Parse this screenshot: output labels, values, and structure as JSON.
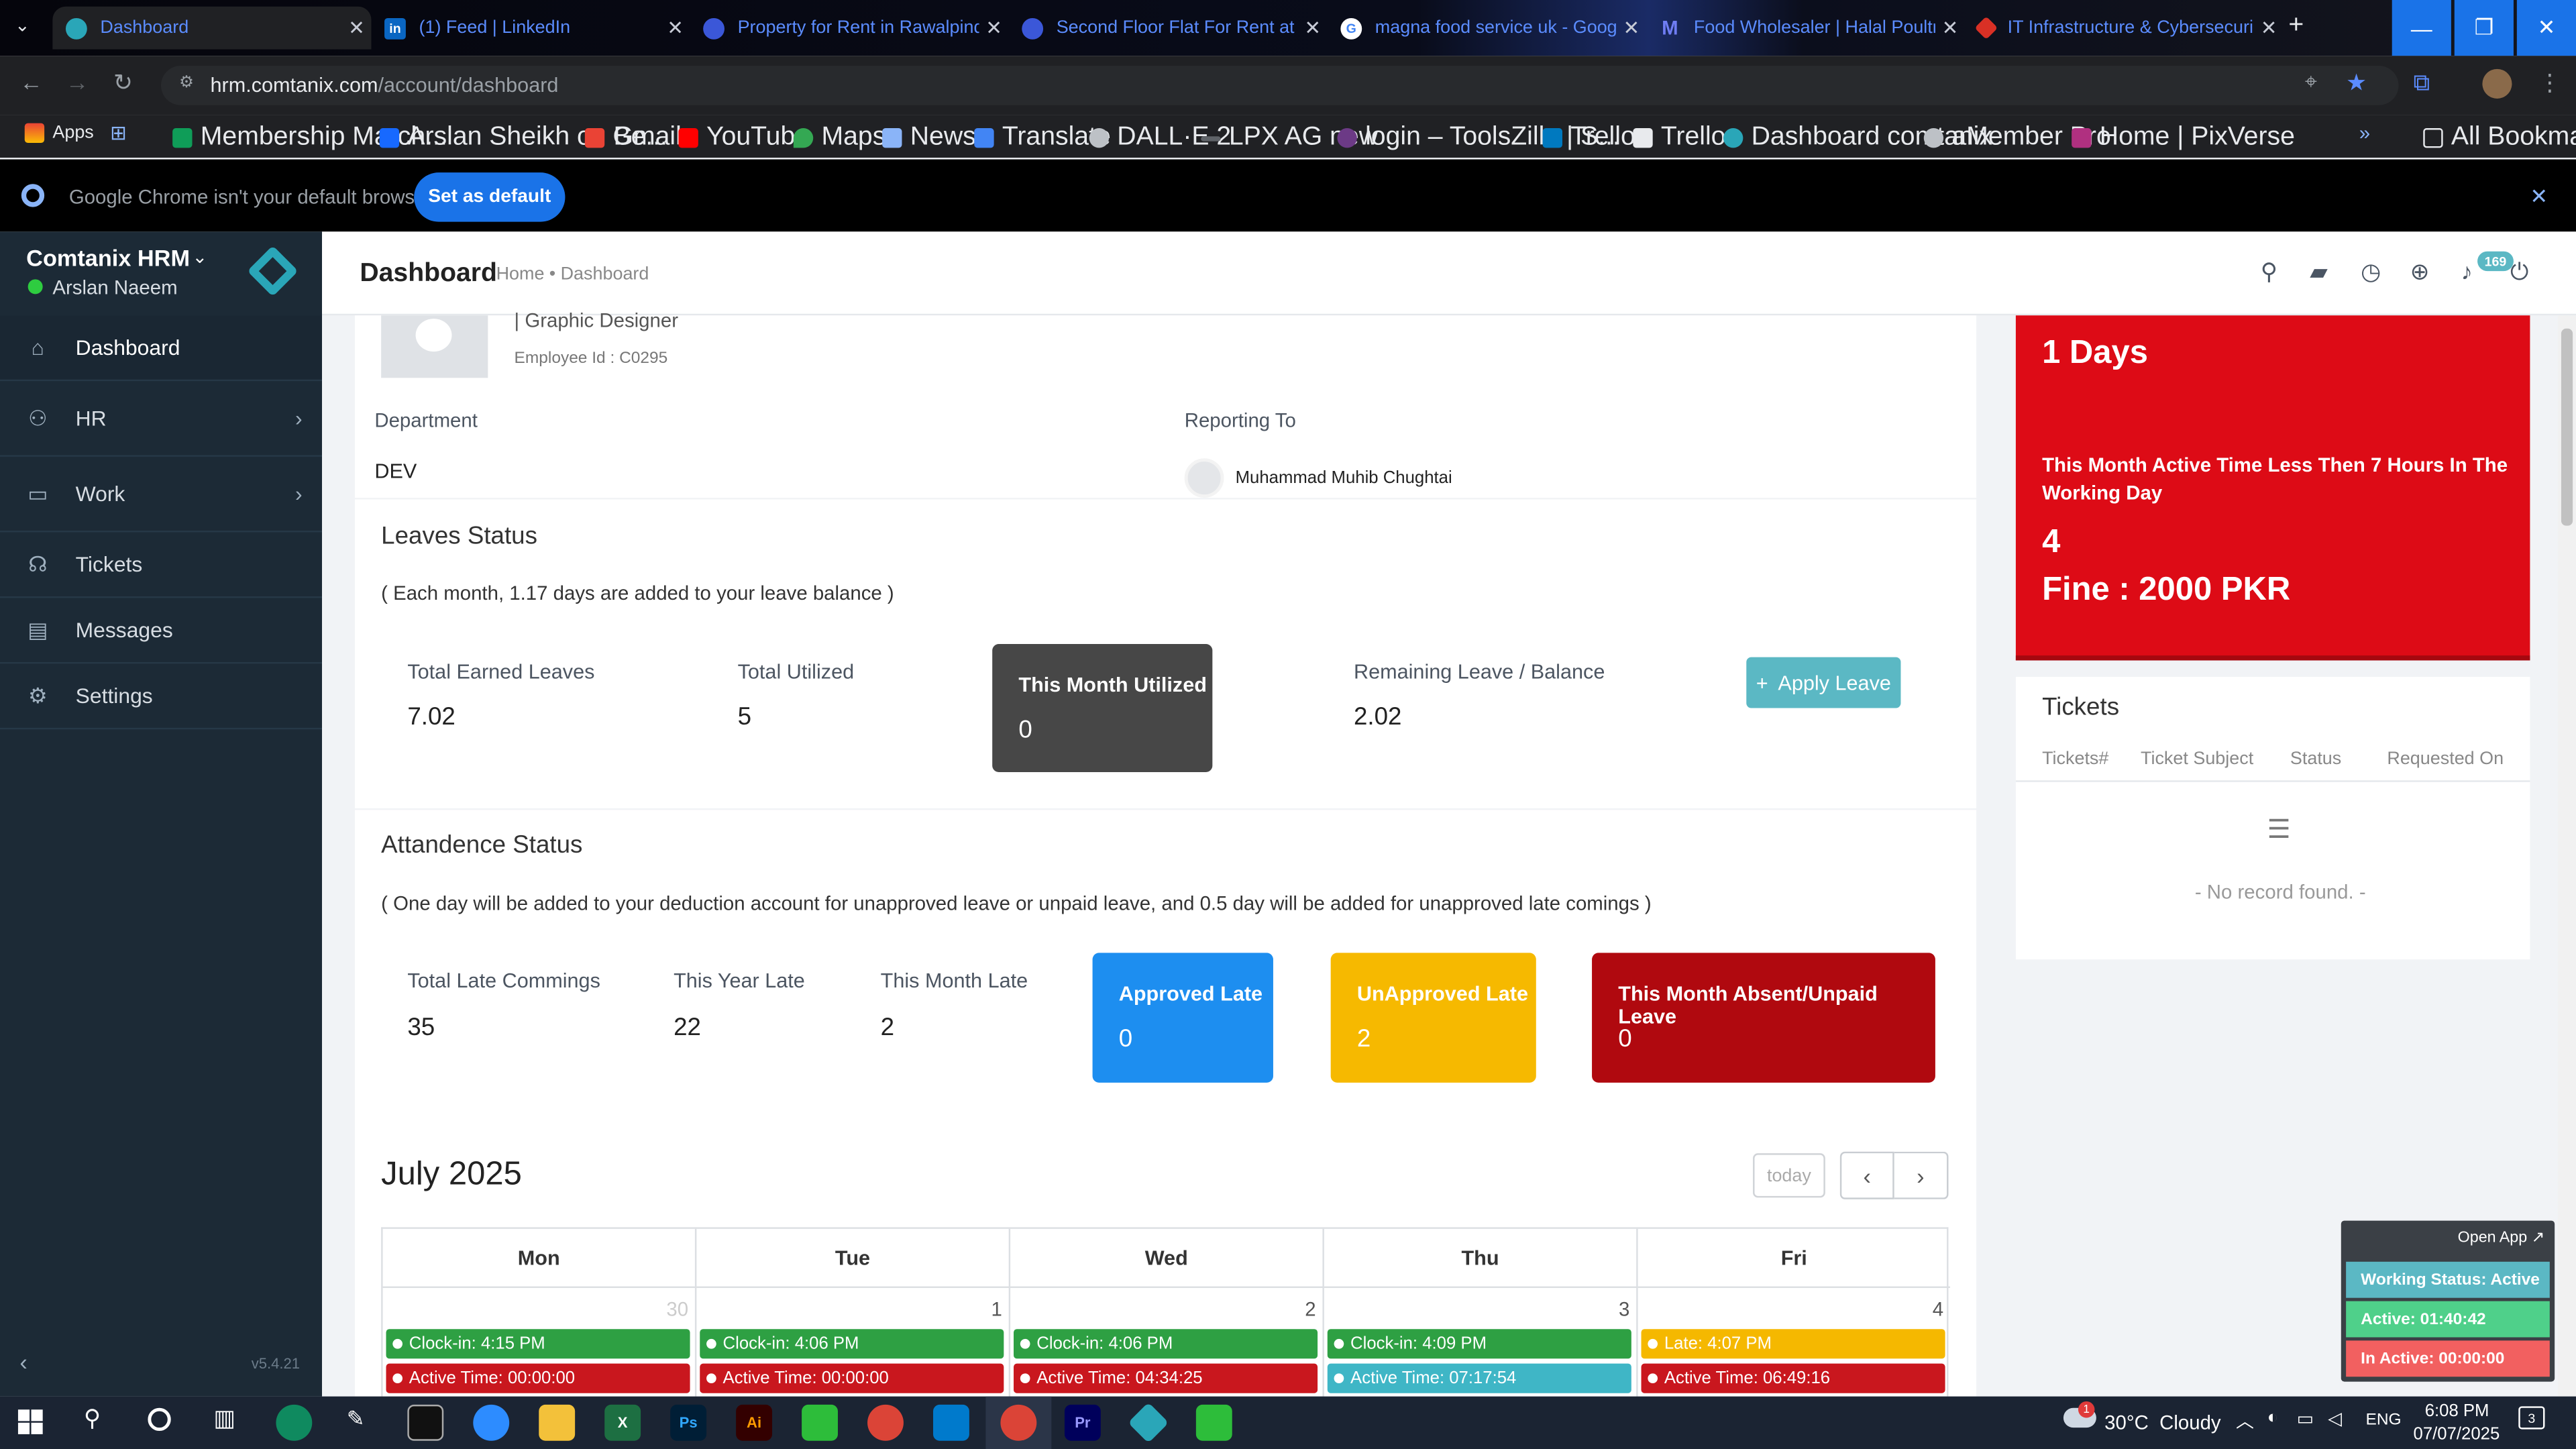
{
  "browser": {
    "tabs": [
      {
        "title": "Dashboard",
        "fav_color": "#2aa6b8"
      },
      {
        "title": "(1) Feed | LinkedIn",
        "fav_color": "#0a66c2",
        "fav_text": "in"
      },
      {
        "title": "Property for Rent in Rawalpindi",
        "fav_color": "#3b57d8"
      },
      {
        "title": "Second Floor Flat For Rent at A",
        "fav_color": "#3b57d8"
      },
      {
        "title": "magna food service uk - Googl",
        "fav_color": "#4285f4",
        "fav_text": "G"
      },
      {
        "title": "Food Wholesaler | Halal Poultry",
        "fav_color": "#6f7df3",
        "fav_text": "M"
      },
      {
        "title": "IT Infrastructure & Cybersecuri",
        "fav_color": "#d93025"
      }
    ],
    "url_host": "hrm.comtanix.com",
    "url_path": "/account/dashboard",
    "bookmarks": [
      {
        "label": "Apps",
        "color": "#ea4335"
      },
      {
        "label": "Membership March...",
        "color": "#0f9d58"
      },
      {
        "label": "Arslan Sheikh on Be...",
        "color": "#1769ff"
      },
      {
        "label": "Gmail",
        "color": "#ea4335"
      },
      {
        "label": "YouTube",
        "color": "#ff0000"
      },
      {
        "label": "Maps",
        "color": "#34a853"
      },
      {
        "label": "News",
        "color": "#8ab4f8"
      },
      {
        "label": "Translate",
        "color": "#4285f4"
      },
      {
        "label": "DALL·E 2",
        "color": "#bdc1c6"
      },
      {
        "label": "LPX AG new",
        "color": "#5f6368"
      },
      {
        "label": "login – ToolsZilla | S...",
        "color": "#6c3a86"
      },
      {
        "label": "Trello",
        "color": "#0079bf"
      },
      {
        "label": "Trello",
        "color": "#e8eaed"
      },
      {
        "label": "Dashboard comtanix",
        "color": "#2aa6b8"
      },
      {
        "label": "aMember Pro",
        "color": "#bdc1c6"
      },
      {
        "label": "Home | PixVerse",
        "color": "#b03080"
      }
    ],
    "all_bookmarks": "All Bookmarks",
    "infobar_text": "Google Chrome isn't your default browser",
    "infobar_button": "Set as default"
  },
  "sidebar": {
    "app_name": "Comtanix HRM",
    "user_name": "Arslan Naeem",
    "items": [
      {
        "label": "Dashboard",
        "icon": "home-icon"
      },
      {
        "label": "HR",
        "icon": "users-icon"
      },
      {
        "label": "Work",
        "icon": "briefcase-icon"
      },
      {
        "label": "Tickets",
        "icon": "headset-icon"
      },
      {
        "label": "Messages",
        "icon": "message-icon"
      },
      {
        "label": "Settings",
        "icon": "gear-icon"
      }
    ],
    "version": "v5.4.21"
  },
  "header": {
    "title": "Dashboard",
    "breadcrumb_home": "Home",
    "breadcrumb_sep": "•",
    "breadcrumb_current": "Dashboard",
    "notification_count": "169"
  },
  "profile": {
    "role": "| Graphic Designer",
    "employee_id": "Employee Id : C0295",
    "department_label": "Department",
    "department_value": "DEV",
    "reporting_label": "Reporting To",
    "reporting_value": "Muhammad Muhib Chughtai"
  },
  "leaves": {
    "title": "Leaves Status",
    "note": "( Each month, 1.17 days are added to your leave balance )",
    "earned_label": "Total Earned Leaves",
    "earned_value": "7.02",
    "utilized_label": "Total Utilized",
    "utilized_value": "5",
    "month_label": "This Month Utilized",
    "month_value": "0",
    "remaining_label": "Remaining Leave / Balance",
    "remaining_value": "2.02",
    "apply_button": "Apply Leave"
  },
  "attendance": {
    "title": "Attandence Status",
    "note": "( One day will be added to your deduction account for unapproved leave or unpaid leave, and 0.5 day will be added for unapproved late comings )",
    "total_late_label": "Total Late Commings",
    "total_late_value": "35",
    "year_late_label": "This Year Late",
    "year_late_value": "22",
    "month_late_label": "This Month Late",
    "month_late_value": "2",
    "approved_label": "Approved Late",
    "approved_value": "0",
    "unapproved_label": "UnApproved Late",
    "unapproved_value": "2",
    "absent_label": "This Month Absent/Unpaid Leave",
    "absent_value": "0"
  },
  "calendar": {
    "title": "July 2025",
    "today_button": "today",
    "days": [
      {
        "name": "Mon",
        "num": "30",
        "events": [
          {
            "text": "Clock-in: 4:15 PM",
            "color": "#2ea043"
          },
          {
            "text": "Active Time: 00:00:00",
            "color": "#c9171e"
          }
        ]
      },
      {
        "name": "Tue",
        "num": "1",
        "events": [
          {
            "text": "Clock-in: 4:06 PM",
            "color": "#2ea043"
          },
          {
            "text": "Active Time: 00:00:00",
            "color": "#c9171e"
          }
        ]
      },
      {
        "name": "Wed",
        "num": "2",
        "events": [
          {
            "text": "Clock-in: 4:06 PM",
            "color": "#2ea043"
          },
          {
            "text": "Active Time: 04:34:25",
            "color": "#c9171e"
          }
        ]
      },
      {
        "name": "Thu",
        "num": "3",
        "events": [
          {
            "text": "Clock-in: 4:09 PM",
            "color": "#2ea043"
          },
          {
            "text": "Active Time: 07:17:54",
            "color": "#3fb6c6"
          }
        ]
      },
      {
        "name": "Fri",
        "num": "4",
        "events": [
          {
            "text": "Late: 4:07 PM",
            "color": "#f5b800"
          },
          {
            "text": "Active Time: 06:49:16",
            "color": "#c9171e"
          }
        ]
      }
    ]
  },
  "fine_card": {
    "days": "1 Days",
    "text": "This Month Active Time Less Then 7 Hours In The Working Day",
    "count": "4",
    "fine": "Fine : 2000 PKR"
  },
  "tickets": {
    "title": "Tickets",
    "columns": [
      "Tickets#",
      "Ticket Subject",
      "Status",
      "Requested On"
    ],
    "empty": "- No record found. -"
  },
  "widget": {
    "open_app": "Open App ↗",
    "working_status": "Working Status: Active",
    "active": "Active: 01:40:42",
    "inactive": "In Active: 00:00:00"
  },
  "taskbar": {
    "weather": "30°C  Cloudy",
    "lang": "ENG",
    "time": "6:08 PM",
    "date": "07/07/2025",
    "notif": "3",
    "weather_badge": "1"
  },
  "colors": {
    "fine_red": "#dd0b16",
    "absent_red": "#b0090f",
    "blue": "#1d8ef0",
    "yellow": "#f6b900",
    "teal": "#5bb8c4",
    "dark": "#474747"
  }
}
